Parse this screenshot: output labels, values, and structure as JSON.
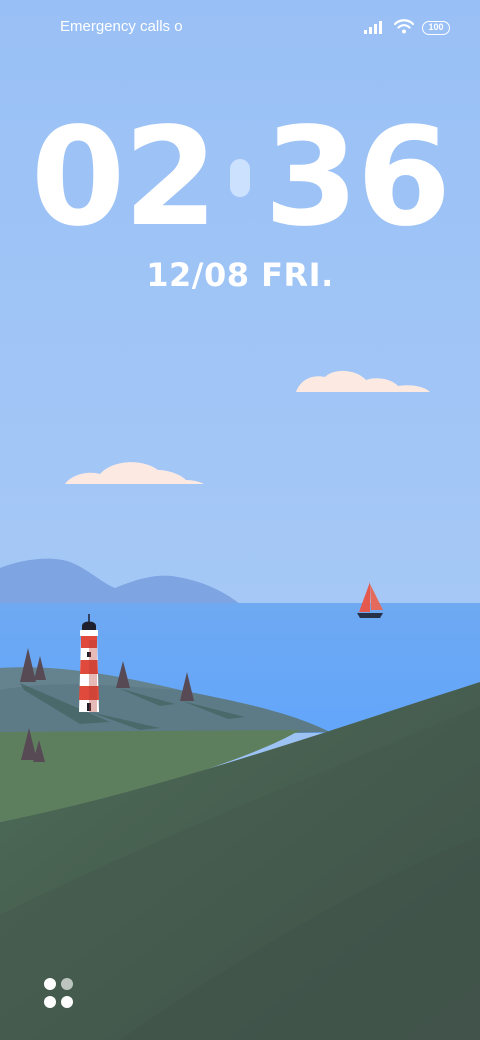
{
  "status_bar": {
    "carrier_text": "Emergency calls o",
    "battery": "100",
    "icons": [
      "signal-icon",
      "wifi-icon",
      "battery-icon"
    ]
  },
  "lock_screen": {
    "hours": "02",
    "minutes": "36",
    "date": "12/08 FRI."
  },
  "shortcut": {
    "icon": "widgets-icon"
  },
  "wallpaper": {
    "sky_color": "#9dc3f5",
    "sea_color": "#6aa8f5",
    "sail_color": "#e2584b",
    "lighthouse_colors": [
      "#e04a3d",
      "#ffffff",
      "#1f1f2e"
    ]
  }
}
